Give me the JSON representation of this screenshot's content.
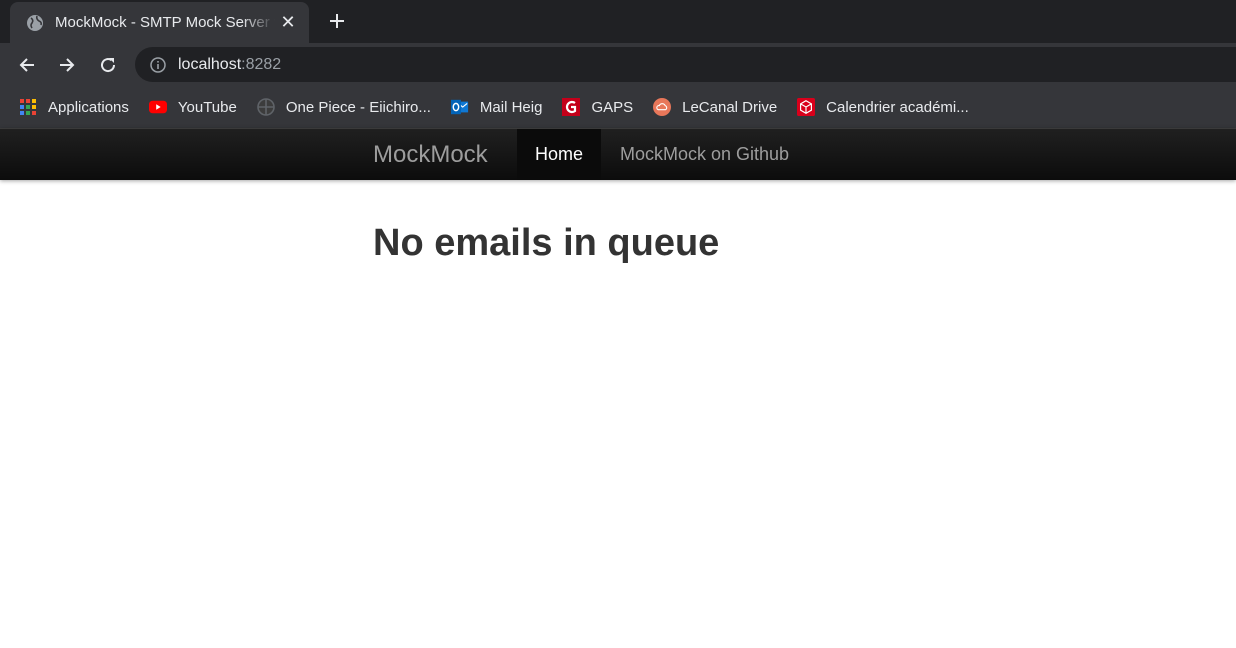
{
  "browser": {
    "tab": {
      "title": "MockMock - SMTP Mock Server v",
      "close": "✕"
    },
    "new_tab": "+",
    "address": {
      "host": "localhost",
      "port": ":8282"
    },
    "bookmarks": [
      {
        "label": "Applications",
        "icon": "apps-grid-icon"
      },
      {
        "label": "YouTube",
        "icon": "youtube-icon"
      },
      {
        "label": "One Piece - Eiichiro...",
        "icon": "globe-icon"
      },
      {
        "label": "Mail Heig",
        "icon": "outlook-icon"
      },
      {
        "label": "GAPS",
        "icon": "gaps-icon"
      },
      {
        "label": "LeCanal Drive",
        "icon": "cloud-icon"
      },
      {
        "label": "Calendrier académi...",
        "icon": "cube-icon"
      }
    ]
  },
  "page": {
    "navbar": {
      "brand": "MockMock",
      "items": [
        {
          "label": "Home",
          "active": true
        },
        {
          "label": "MockMock on Github",
          "active": false
        }
      ]
    },
    "heading": "No emails in queue"
  },
  "colors": {
    "chrome_dark": "#202124",
    "chrome_toolbar": "#35363a",
    "navbar_bg": "#151515",
    "heading": "#333333"
  }
}
